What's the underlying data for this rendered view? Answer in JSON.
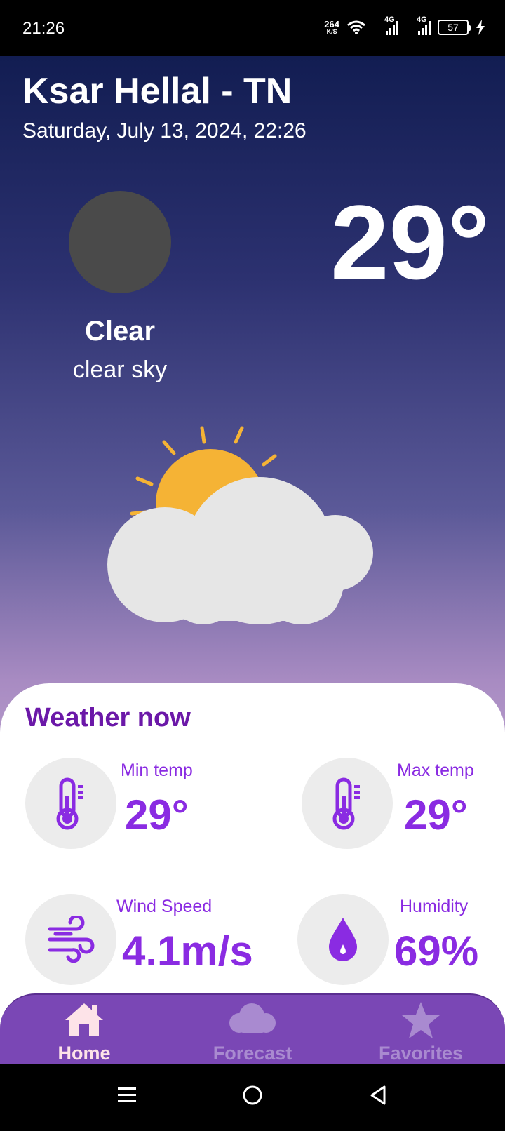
{
  "status_bar": {
    "time": "21:26",
    "net_speed_value": "264",
    "net_speed_unit": "K/S",
    "signal1_label": "4G",
    "signal2_label": "4G",
    "battery": "57"
  },
  "location": {
    "city": "Ksar Hellal - TN",
    "datetime": "Saturday, July 13, 2024, 22:26"
  },
  "current": {
    "temperature": "29°",
    "condition": "Clear",
    "description": "clear sky",
    "illustration_icon": "partly-cloudy-icon"
  },
  "weather_now": {
    "title": "Weather now",
    "min_temp": {
      "label": "Min temp",
      "value": "29°",
      "icon": "thermometer-icon"
    },
    "max_temp": {
      "label": "Max temp",
      "value": "29°",
      "icon": "thermometer-icon"
    },
    "wind": {
      "label": "Wind Speed",
      "value": "4.1m/s",
      "icon": "wind-icon"
    },
    "humidity": {
      "label": "Humidity",
      "value": "69%",
      "icon": "water-drop-icon"
    }
  },
  "nav": {
    "items": [
      {
        "label": "Home",
        "icon": "home-icon",
        "active": true
      },
      {
        "label": "Forecast",
        "icon": "cloud-icon",
        "active": false
      },
      {
        "label": "Favorites",
        "icon": "star-icon",
        "active": false
      }
    ]
  },
  "colors": {
    "accent": "#8a2be2",
    "title": "#6b18a8",
    "nav_bg": "#7a47b5",
    "sun": "#f5b335",
    "cloud": "#e6e6e6"
  }
}
